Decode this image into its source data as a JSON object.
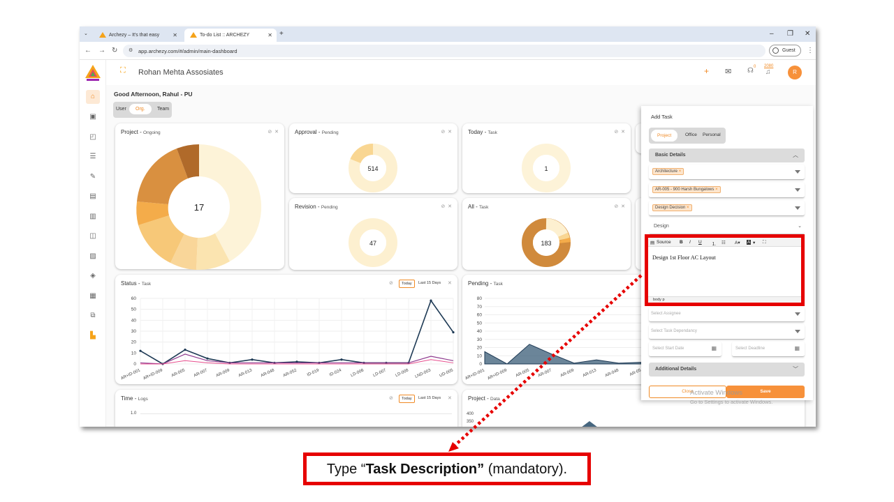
{
  "browser": {
    "tabs": [
      {
        "title": "Archezy – It's that easy"
      },
      {
        "title": "To-do List :: ARCHEZY"
      }
    ],
    "new_tab": "+",
    "url": "app.archezy.com/#/admin/main-dashboard",
    "profile": "Guest",
    "controls": [
      "–",
      "❐",
      "✕"
    ]
  },
  "header": {
    "company": "Rohan Mehta Assosiates",
    "add_icon": "+",
    "badge_count_1": "0",
    "badge_count_2": "2080",
    "avatar_letter": "R"
  },
  "greeting": "Good Afternoon, Rahul - PU",
  "view_toggle": {
    "user": "User",
    "org": "Org.",
    "team": "Team"
  },
  "cards": {
    "project": {
      "title": "Project -",
      "sub": "Ongoing",
      "center": "17"
    },
    "approval": {
      "title": "Approval -",
      "sub": "Pending",
      "center": "514"
    },
    "today": {
      "title": "Today -",
      "sub": "Task",
      "center": "1"
    },
    "revision": {
      "title": "Revision -",
      "sub": "Pending",
      "center": "47"
    },
    "all": {
      "title": "All -",
      "sub": "Task",
      "center": "183"
    },
    "status": {
      "title": "Status -",
      "sub": "Task",
      "today": "Today",
      "last15": "Last 15 Days"
    },
    "pending": {
      "title": "Pending -",
      "sub": "Task"
    },
    "time": {
      "title": "Time -",
      "sub": "Logs",
      "today": "Today",
      "last15": "Last 15 Days"
    },
    "project_data": {
      "title": "Project -",
      "sub": "Data"
    }
  },
  "status_chart": {
    "y_ticks": [
      "60",
      "50",
      "40",
      "30",
      "20",
      "10",
      "0"
    ],
    "x_labels": [
      "AR+ID-001",
      "AR+ID-009",
      "AR-005",
      "AR-007",
      "AR-009",
      "AR-013",
      "AR-048",
      "AR-052",
      "ID-019",
      "ID-024",
      "LD-006",
      "LD-007",
      "LD-008",
      "LND-003",
      "UD-005"
    ]
  },
  "pending_chart": {
    "y_ticks": [
      "80",
      "70",
      "60",
      "50",
      "40",
      "30",
      "20",
      "10",
      "0"
    ],
    "x_labels": [
      "AR+ID-001",
      "AR+ID-009",
      "AR-005",
      "AR-007",
      "AR-009",
      "AR-013",
      "AR-048",
      "AR-05"
    ]
  },
  "time_chart": {
    "y_ticks": [
      "1.0"
    ]
  },
  "project_data_chart": {
    "y_ticks": [
      "400",
      "350"
    ]
  },
  "add_task": {
    "title": "Add Task",
    "tabs": {
      "project": "Project",
      "office": "Office",
      "personal": "Personal"
    },
    "basic_details": "Basic Details",
    "field_1": "Architecture",
    "field_2": "AR-005 - 900 Harsh Bungalows",
    "field_3": "Design Decision",
    "field_4": "Design",
    "editor": {
      "source": "Source",
      "text": "Design 1st Floor AC Layout",
      "path": "body  p"
    },
    "select_assignee": "Select Assignee",
    "select_dependency": "Select Task Dependancy",
    "select_start": "Select Start Date",
    "select_deadline": "Select Deadline",
    "additional_details": "Additional Details",
    "close": "Close",
    "save": "Save"
  },
  "watermark": {
    "line1": "Activate Windows",
    "line2": "Go to Settings to activate Windows."
  },
  "callout": {
    "pre": "Type “",
    "bold": "Task Description”",
    "post": " (mandatory)."
  }
}
